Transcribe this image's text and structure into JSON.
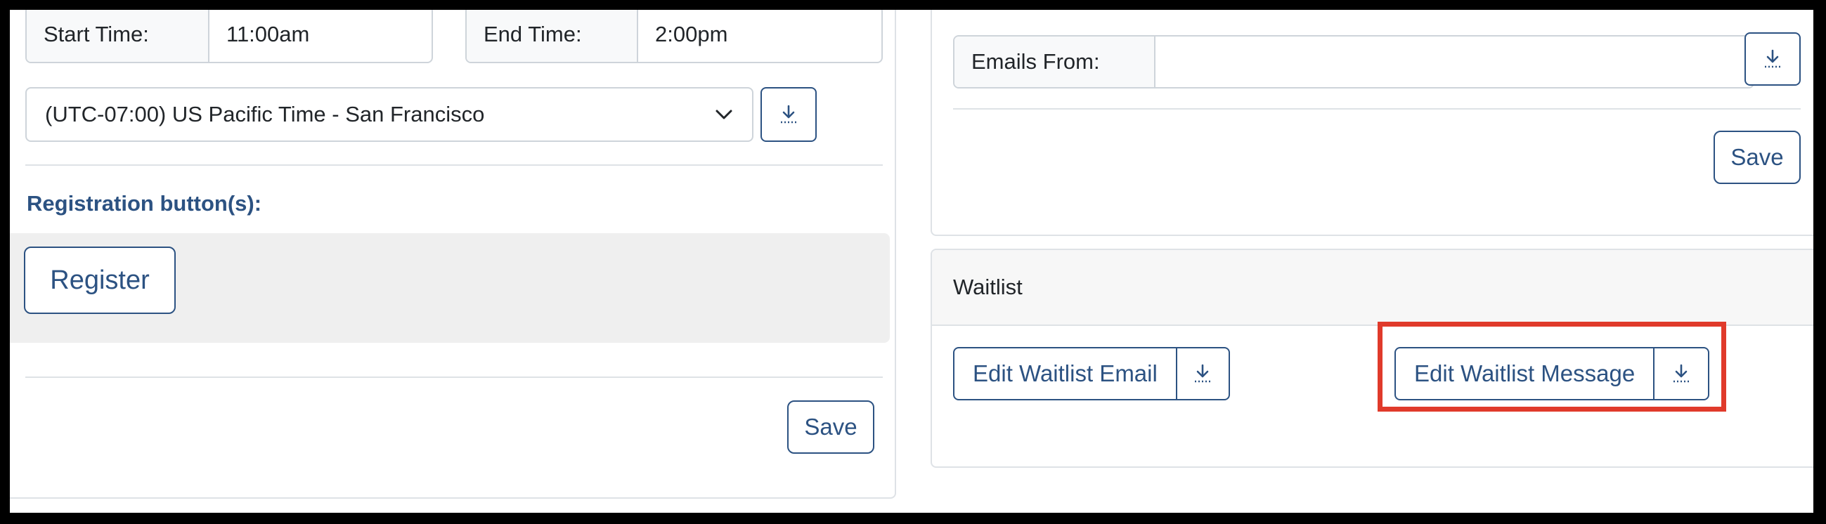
{
  "left_panel": {
    "start_time": {
      "label": "Start Time:",
      "value": "11:00am"
    },
    "end_time": {
      "label": "End Time:",
      "value": "2:00pm"
    },
    "timezone": {
      "selected": "(UTC-07:00) US Pacific Time - San Francisco"
    },
    "registration_heading": "Registration button(s):",
    "register_button": "Register",
    "save_button": "Save"
  },
  "right_panel": {
    "emails_from": {
      "label": "Emails From:",
      "value": ""
    },
    "save_button": "Save",
    "waitlist": {
      "header": "Waitlist",
      "edit_email_button": "Edit Waitlist Email",
      "edit_message_button": "Edit Waitlist Message"
    }
  },
  "colors": {
    "accent": "#2c5282",
    "highlight": "#e03a2b",
    "border": "#ced4da"
  },
  "icons": [
    "download-icon",
    "chevron-down-icon"
  ]
}
